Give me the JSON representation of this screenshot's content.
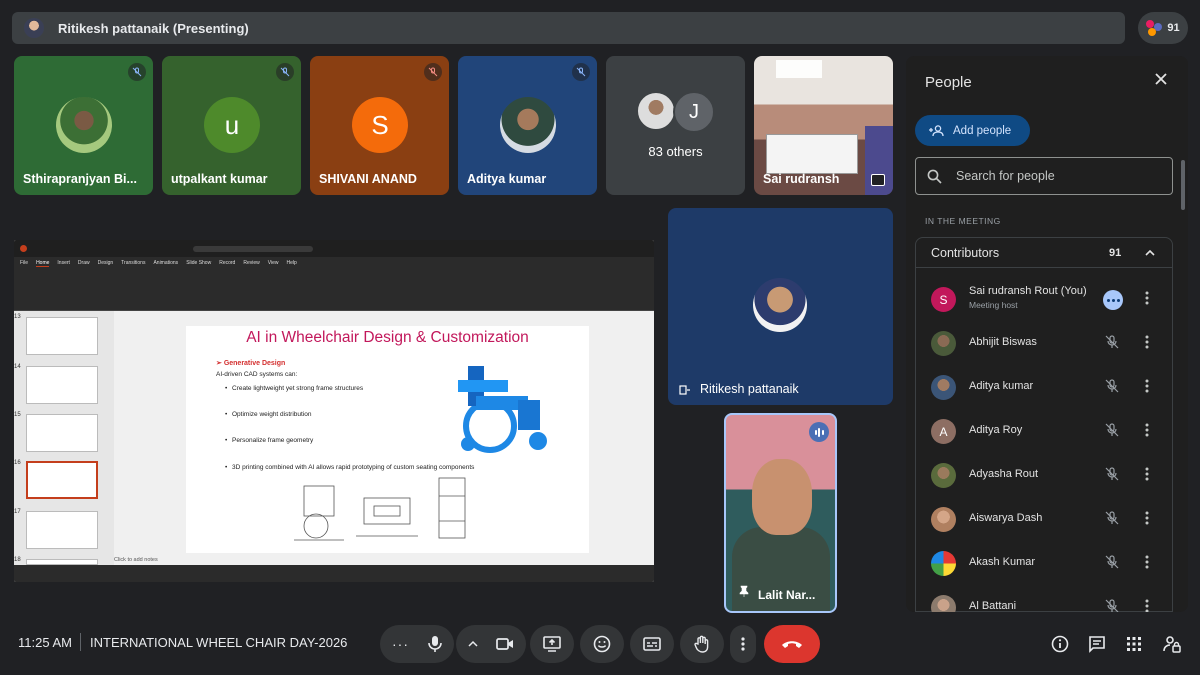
{
  "topbar": {
    "presenter_title": "Ritikesh pattanaik (Presenting)",
    "participant_count": "91"
  },
  "tiles": [
    {
      "name": "Sthirapranjyan Bi...",
      "bg": "#2e6b35",
      "avatar": "photo"
    },
    {
      "name": "utpalkant kumar",
      "bg": "#35622d",
      "avatar_letter": "u",
      "avatar_color": "#4e8a2b"
    },
    {
      "name": "SHIVANI ANAND",
      "bg": "#8a3f12",
      "avatar_letter": "S",
      "avatar_color": "#f46b0b"
    },
    {
      "name": "Aditya kumar",
      "bg": "#21457a",
      "avatar": "photo"
    },
    {
      "name": "83 others",
      "bg": "#3c4043",
      "avatar_letter": "J"
    },
    {
      "name": "Sai rudransh",
      "bg": "#8d6e63",
      "avatar": "camera"
    }
  ],
  "slide": {
    "title": "AI in Wheelchair Design & Customization",
    "subtitle": "Generative Design",
    "intro": "AI-driven CAD systems can:",
    "bullets": [
      "Create lightweight yet strong frame structures",
      "Optimize weight distribution",
      "Personalize frame geometry",
      "3D printing combined with AI allows rapid prototyping of custom seating components"
    ],
    "notes_placeholder": "Click to add notes",
    "thumb_numbers": [
      "13",
      "14",
      "15",
      "16",
      "17",
      "18"
    ],
    "menu": [
      "File",
      "Home",
      "Insert",
      "Draw",
      "Design",
      "Transitions",
      "Animations",
      "Slide Show",
      "Record",
      "Review",
      "View",
      "Help"
    ]
  },
  "presenter_tile": {
    "name": "Ritikesh pattanaik"
  },
  "speaker_tile": {
    "name": "Lalit Nar..."
  },
  "people": {
    "title": "People",
    "add_label": "Add people",
    "search_placeholder": "Search for people",
    "section": "IN THE MEETING",
    "group_label": "Contributors",
    "group_count": "91",
    "rows": [
      {
        "name": "Sai rudransh Rout (You)",
        "sub": "Meeting host",
        "letter": "S",
        "color": "#c2185b"
      },
      {
        "name": "Abhijit Biswas",
        "color": "#4a5a3a"
      },
      {
        "name": "Aditya kumar",
        "color": "#3b5577"
      },
      {
        "name": "Aditya Roy",
        "letter": "A",
        "color": "#8d6e63"
      },
      {
        "name": "Adyasha Rout",
        "color": "#5a6b3c"
      },
      {
        "name": "Aiswarya Dash",
        "color": "#b08060"
      },
      {
        "name": "Akash Kumar",
        "color": "#7aa33c"
      },
      {
        "name": "Al Battani",
        "color": "#8c7b6d"
      }
    ]
  },
  "bottom": {
    "time": "11:25 AM",
    "meeting_name": "INTERNATIONAL WHEEL CHAIR DAY-2026"
  }
}
